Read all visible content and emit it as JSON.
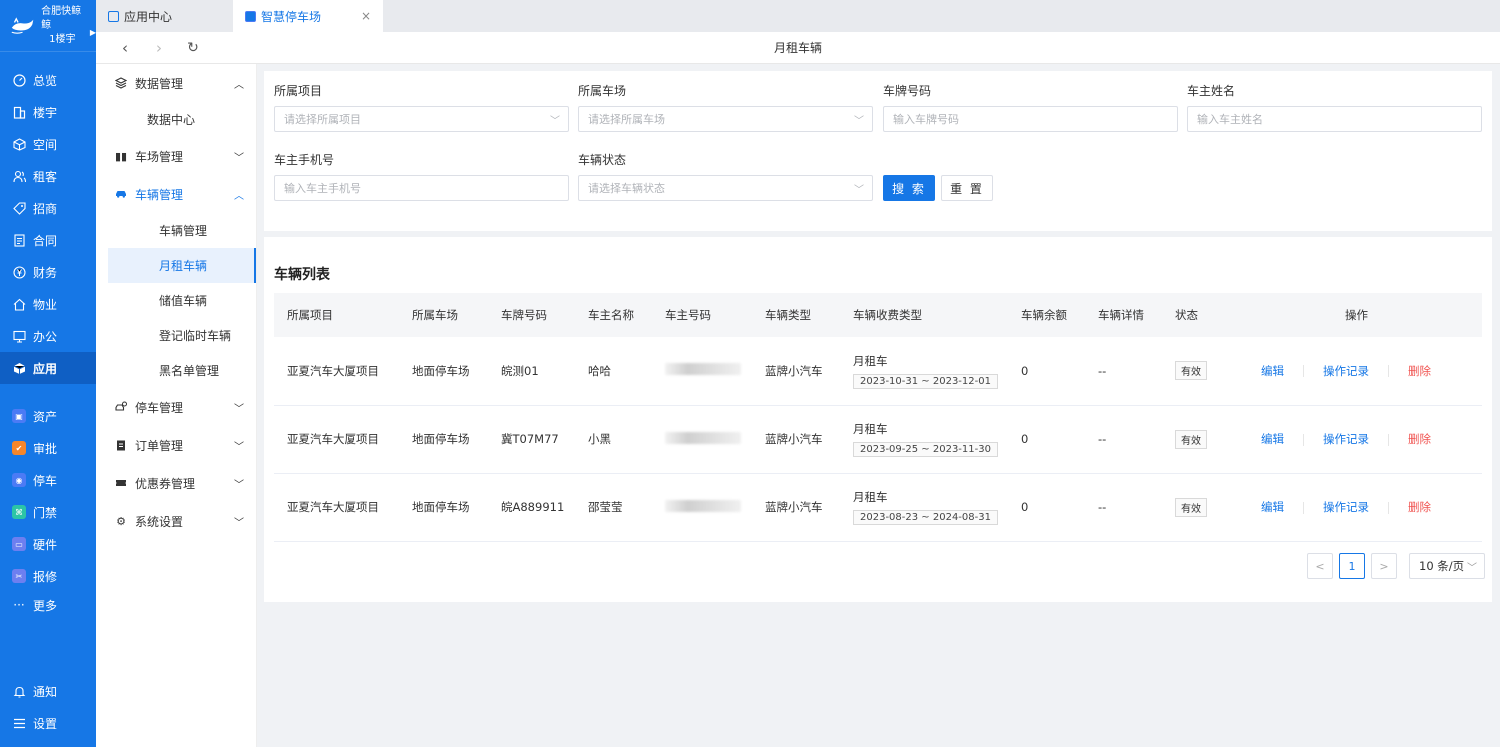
{
  "brand": {
    "org_line1": "合肥快鲸鲸",
    "org_line2": "1楼宇"
  },
  "appnav": {
    "items": [
      {
        "label": "总览",
        "icon": "dashboard-icon"
      },
      {
        "label": "楼宇",
        "icon": "building-icon"
      },
      {
        "label": "空间",
        "icon": "cube-icon"
      },
      {
        "label": "租客",
        "icon": "users-icon"
      },
      {
        "label": "招商",
        "icon": "tag-icon"
      },
      {
        "label": "合同",
        "icon": "document-icon"
      },
      {
        "label": "财务",
        "icon": "yen-icon"
      },
      {
        "label": "物业",
        "icon": "home-icon"
      },
      {
        "label": "办公",
        "icon": "monitor-icon"
      },
      {
        "label": "应用",
        "icon": "app-box-icon"
      }
    ],
    "apps": [
      {
        "label": "资产",
        "color": "#4b7bf5"
      },
      {
        "label": "审批",
        "color": "#f5862b"
      },
      {
        "label": "停车",
        "color": "#4b7bf5"
      },
      {
        "label": "门禁",
        "color": "#2cc5a6"
      },
      {
        "label": "硬件",
        "color": "#6d7ff0"
      },
      {
        "label": "报修",
        "color": "#6d7ff0"
      }
    ],
    "more": "更多",
    "notify": "通知",
    "settings": "设置"
  },
  "tabs": [
    {
      "label": "应用中心"
    },
    {
      "label": "智慧停车场",
      "close": "×"
    }
  ],
  "addrbar": {
    "back": "‹",
    "forward": "›",
    "refresh": "↻",
    "title": "月租车辆"
  },
  "submenu": {
    "data_mgmt": "数据管理",
    "data_center": "数据中心",
    "lot_mgmt": "车场管理",
    "vehicle_mgmt": "车辆管理",
    "vehicle_items": [
      "车辆管理",
      "月租车辆",
      "储值车辆",
      "登记临时车辆",
      "黑名单管理"
    ],
    "parking_mgmt": "停车管理",
    "order_mgmt": "订单管理",
    "coupon_mgmt": "优惠券管理",
    "sys_settings": "系统设置"
  },
  "filter": {
    "project": {
      "label": "所属项目",
      "placeholder": "请选择所属项目"
    },
    "lot": {
      "label": "所属车场",
      "placeholder": "请选择所属车场"
    },
    "plate": {
      "label": "车牌号码",
      "placeholder": "输入车牌号码"
    },
    "owner": {
      "label": "车主姓名",
      "placeholder": "输入车主姓名"
    },
    "phone": {
      "label": "车主手机号",
      "placeholder": "输入车主手机号"
    },
    "status": {
      "label": "车辆状态",
      "placeholder": "请选择车辆状态"
    },
    "search": "搜 索",
    "reset": "重 置"
  },
  "list": {
    "title": "车辆列表",
    "columns": [
      "所属项目",
      "所属车场",
      "车牌号码",
      "车主名称",
      "车主号码",
      "车辆类型",
      "车辆收费类型",
      "车辆余额",
      "车辆详情",
      "状态",
      "操作"
    ],
    "rows": [
      {
        "project": "亚夏汽车大厦项目",
        "lot": "地面停车场",
        "plate": "皖测01",
        "owner": "哈哈",
        "car_type": "蓝牌小汽车",
        "fee_type": "月租车",
        "period": "2023-10-31 ~ 2023-12-01",
        "balance": "0",
        "detail": "--",
        "status": "有效"
      },
      {
        "project": "亚夏汽车大厦项目",
        "lot": "地面停车场",
        "plate": "冀T07M77",
        "owner": "小黑",
        "car_type": "蓝牌小汽车",
        "fee_type": "月租车",
        "period": "2023-09-25 ~ 2023-11-30",
        "balance": "0",
        "detail": "--",
        "status": "有效"
      },
      {
        "project": "亚夏汽车大厦项目",
        "lot": "地面停车场",
        "plate": "皖A889911",
        "owner": "邵莹莹",
        "car_type": "蓝牌小汽车",
        "fee_type": "月租车",
        "period": "2023-08-23 ~ 2024-08-31",
        "balance": "0",
        "detail": "--",
        "status": "有效"
      }
    ],
    "actions": {
      "edit": "编辑",
      "log": "操作记录",
      "delete": "删除"
    }
  },
  "pager": {
    "prev": "<",
    "page": "1",
    "next": ">",
    "size": "10 条/页"
  },
  "colors": {
    "primary": "#1677e6",
    "danger": "#f0524f",
    "nav_bg": "#1677e6"
  }
}
